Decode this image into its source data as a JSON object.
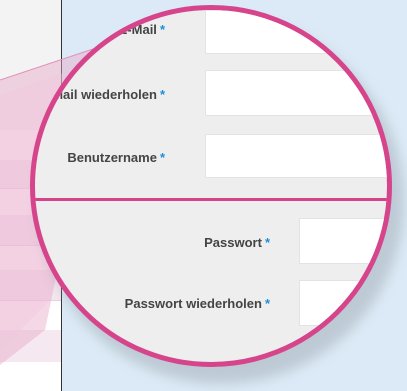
{
  "form": {
    "email": {
      "label": "E-Mail",
      "required_mark": "*"
    },
    "email_repeat": {
      "label": "E-Mail wiederholen",
      "required_mark": "*"
    },
    "username": {
      "label": "Benutzername",
      "required_mark": "*"
    },
    "password": {
      "label": "Passwort",
      "required_mark": "*"
    },
    "password_repeat": {
      "label": "Passwort wiederholen",
      "required_mark": "*"
    }
  },
  "colors": {
    "lens_border": "#d6458b",
    "required_marker": "#1f8fd8",
    "background_blue": "#dbeaf6"
  }
}
